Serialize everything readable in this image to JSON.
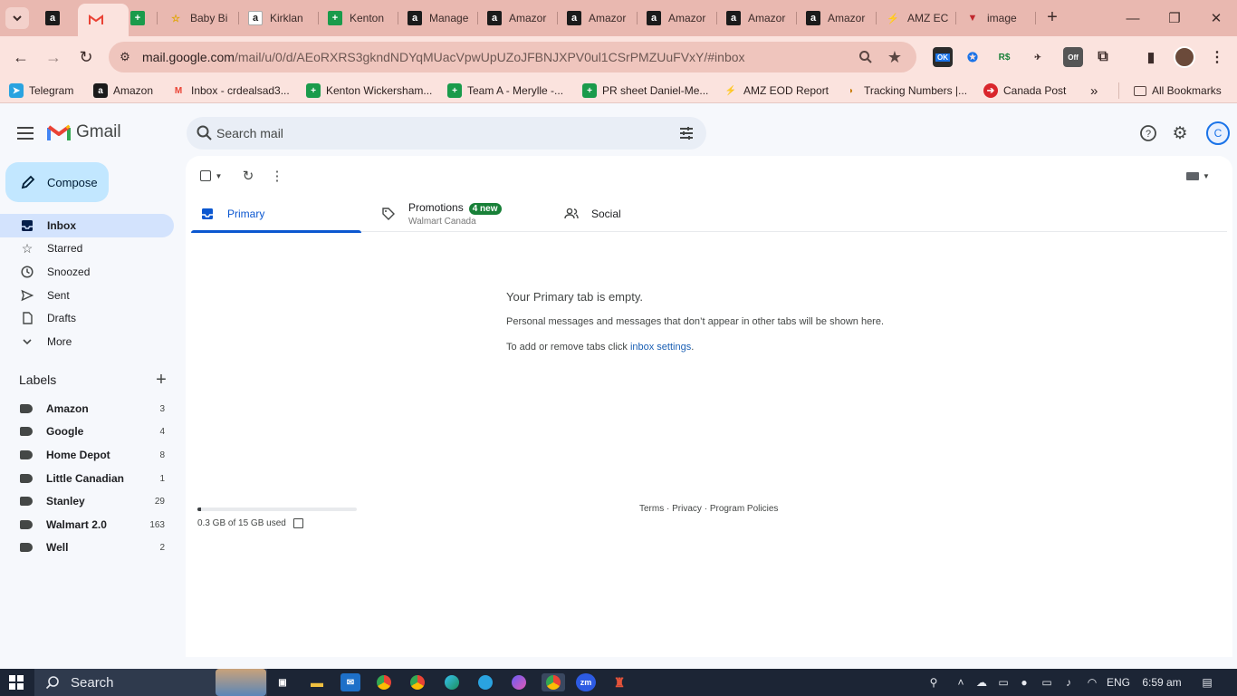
{
  "browser": {
    "tabs": [
      {
        "title": "",
        "favicon": "amazon-icon"
      },
      {
        "title": "",
        "favicon": "gmail-icon",
        "active": true
      },
      {
        "title": "",
        "favicon": "sheets-icon"
      },
      {
        "title": "Baby Bi",
        "favicon": "star-icon"
      },
      {
        "title": "Kirklan",
        "favicon": "amazon-icon"
      },
      {
        "title": "Kenton",
        "favicon": "sheets-icon"
      },
      {
        "title": "Manage",
        "favicon": "amazon-icon"
      },
      {
        "title": "Amazor",
        "favicon": "amazon-icon"
      },
      {
        "title": "Amazor",
        "favicon": "amazon-icon"
      },
      {
        "title": "Amazor",
        "favicon": "amazon-icon"
      },
      {
        "title": "Amazor",
        "favicon": "amazon-icon"
      },
      {
        "title": "Amazor",
        "favicon": "amazon-icon"
      },
      {
        "title": "AMZ EC",
        "favicon": "bolt-icon"
      },
      {
        "title": "image",
        "favicon": "image-icon"
      }
    ],
    "url_host": "mail.google.com",
    "url_path": "/mail/u/0/d/AEoRXRS3gkndNDYqMUacVpwUpUZoJFBNJXPV0ul1CSrPMZUuFVxY/#inbox",
    "ext_badge_ok": "OK",
    "ext_badge_off": "Off",
    "bookmarks": [
      {
        "label": "Telegram"
      },
      {
        "label": "Amazon"
      },
      {
        "label": "Inbox - crdealsad3..."
      },
      {
        "label": "Kenton Wickersham..."
      },
      {
        "label": "Team A - Merylle -..."
      },
      {
        "label": "PR sheet Daniel-Me..."
      },
      {
        "label": "AMZ EOD Report"
      },
      {
        "label": "Tracking Numbers |..."
      },
      {
        "label": "Canada Post"
      }
    ],
    "all_bookmarks": "All Bookmarks"
  },
  "gmail": {
    "logo_text": "Gmail",
    "search_placeholder": "Search mail",
    "compose_label": "Compose",
    "account_initial": "C",
    "nav": [
      {
        "label": "Inbox",
        "icon": "inbox-icon",
        "active": true
      },
      {
        "label": "Starred",
        "icon": "star-icon"
      },
      {
        "label": "Snoozed",
        "icon": "clock-icon"
      },
      {
        "label": "Sent",
        "icon": "send-icon"
      },
      {
        "label": "Drafts",
        "icon": "draft-icon"
      },
      {
        "label": "More",
        "icon": "chevron-down-icon"
      }
    ],
    "labels_title": "Labels",
    "labels": [
      {
        "name": "Amazon",
        "count": "3"
      },
      {
        "name": "Google",
        "count": "4"
      },
      {
        "name": "Home Depot",
        "count": "8"
      },
      {
        "name": "Little Canadian",
        "count": "1"
      },
      {
        "name": "Stanley",
        "count": "29"
      },
      {
        "name": "Walmart 2.0",
        "count": "163"
      },
      {
        "name": "Well",
        "count": "2"
      }
    ],
    "inbox_tabs": {
      "primary": "Primary",
      "promotions": "Promotions",
      "promotions_badge": "4 new",
      "promotions_sub": "Walmart Canada",
      "social": "Social"
    },
    "empty": {
      "title": "Your Primary tab is empty.",
      "line1": "Personal messages and messages that don’t appear in other tabs will be shown here.",
      "line2_prefix": "To add or remove tabs click ",
      "line2_link": "inbox settings",
      "line2_suffix": "."
    },
    "storage": {
      "text": "0.3 GB of 15 GB used",
      "fraction": 0.02
    },
    "footer": {
      "terms": "Terms",
      "privacy": "Privacy",
      "policies": "Program Policies",
      "sep": " · "
    }
  },
  "taskbar": {
    "search_label": "Search",
    "language": "ENG",
    "time": "6:59 am"
  },
  "colors": {
    "chrome_frame": "#e9b8b0",
    "chrome_toolbar": "#fbe3de",
    "compose_bg": "#c2e7ff",
    "active_nav": "#d3e3fd",
    "primary_blue": "#0b57d0",
    "badge_green": "#188038",
    "taskbar": "#1c2535"
  }
}
